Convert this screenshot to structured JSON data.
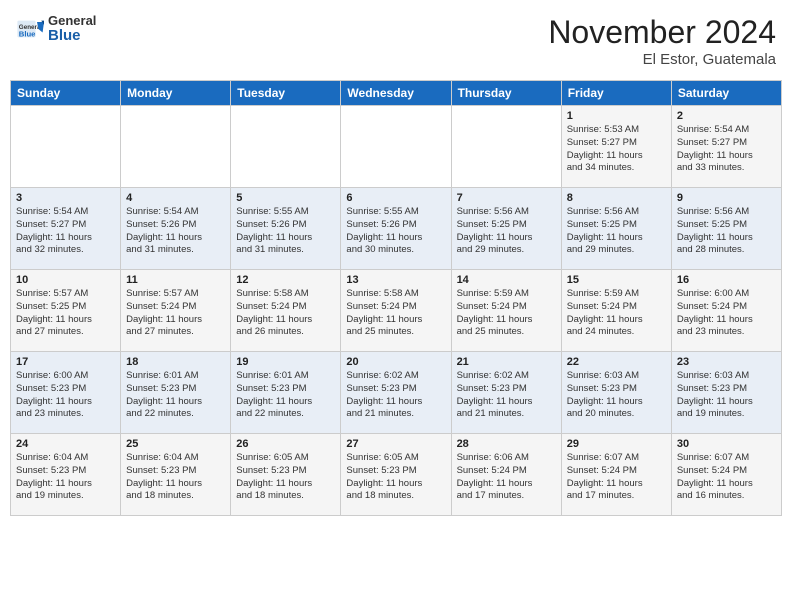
{
  "header": {
    "logo_general": "General",
    "logo_blue": "Blue",
    "month": "November 2024",
    "location": "El Estor, Guatemala"
  },
  "weekdays": [
    "Sunday",
    "Monday",
    "Tuesday",
    "Wednesday",
    "Thursday",
    "Friday",
    "Saturday"
  ],
  "weeks": [
    [
      {
        "day": "",
        "info": ""
      },
      {
        "day": "",
        "info": ""
      },
      {
        "day": "",
        "info": ""
      },
      {
        "day": "",
        "info": ""
      },
      {
        "day": "",
        "info": ""
      },
      {
        "day": "1",
        "info": "Sunrise: 5:53 AM\nSunset: 5:27 PM\nDaylight: 11 hours\nand 34 minutes."
      },
      {
        "day": "2",
        "info": "Sunrise: 5:54 AM\nSunset: 5:27 PM\nDaylight: 11 hours\nand 33 minutes."
      }
    ],
    [
      {
        "day": "3",
        "info": "Sunrise: 5:54 AM\nSunset: 5:27 PM\nDaylight: 11 hours\nand 32 minutes."
      },
      {
        "day": "4",
        "info": "Sunrise: 5:54 AM\nSunset: 5:26 PM\nDaylight: 11 hours\nand 31 minutes."
      },
      {
        "day": "5",
        "info": "Sunrise: 5:55 AM\nSunset: 5:26 PM\nDaylight: 11 hours\nand 31 minutes."
      },
      {
        "day": "6",
        "info": "Sunrise: 5:55 AM\nSunset: 5:26 PM\nDaylight: 11 hours\nand 30 minutes."
      },
      {
        "day": "7",
        "info": "Sunrise: 5:56 AM\nSunset: 5:25 PM\nDaylight: 11 hours\nand 29 minutes."
      },
      {
        "day": "8",
        "info": "Sunrise: 5:56 AM\nSunset: 5:25 PM\nDaylight: 11 hours\nand 29 minutes."
      },
      {
        "day": "9",
        "info": "Sunrise: 5:56 AM\nSunset: 5:25 PM\nDaylight: 11 hours\nand 28 minutes."
      }
    ],
    [
      {
        "day": "10",
        "info": "Sunrise: 5:57 AM\nSunset: 5:25 PM\nDaylight: 11 hours\nand 27 minutes."
      },
      {
        "day": "11",
        "info": "Sunrise: 5:57 AM\nSunset: 5:24 PM\nDaylight: 11 hours\nand 27 minutes."
      },
      {
        "day": "12",
        "info": "Sunrise: 5:58 AM\nSunset: 5:24 PM\nDaylight: 11 hours\nand 26 minutes."
      },
      {
        "day": "13",
        "info": "Sunrise: 5:58 AM\nSunset: 5:24 PM\nDaylight: 11 hours\nand 25 minutes."
      },
      {
        "day": "14",
        "info": "Sunrise: 5:59 AM\nSunset: 5:24 PM\nDaylight: 11 hours\nand 25 minutes."
      },
      {
        "day": "15",
        "info": "Sunrise: 5:59 AM\nSunset: 5:24 PM\nDaylight: 11 hours\nand 24 minutes."
      },
      {
        "day": "16",
        "info": "Sunrise: 6:00 AM\nSunset: 5:24 PM\nDaylight: 11 hours\nand 23 minutes."
      }
    ],
    [
      {
        "day": "17",
        "info": "Sunrise: 6:00 AM\nSunset: 5:23 PM\nDaylight: 11 hours\nand 23 minutes."
      },
      {
        "day": "18",
        "info": "Sunrise: 6:01 AM\nSunset: 5:23 PM\nDaylight: 11 hours\nand 22 minutes."
      },
      {
        "day": "19",
        "info": "Sunrise: 6:01 AM\nSunset: 5:23 PM\nDaylight: 11 hours\nand 22 minutes."
      },
      {
        "day": "20",
        "info": "Sunrise: 6:02 AM\nSunset: 5:23 PM\nDaylight: 11 hours\nand 21 minutes."
      },
      {
        "day": "21",
        "info": "Sunrise: 6:02 AM\nSunset: 5:23 PM\nDaylight: 11 hours\nand 21 minutes."
      },
      {
        "day": "22",
        "info": "Sunrise: 6:03 AM\nSunset: 5:23 PM\nDaylight: 11 hours\nand 20 minutes."
      },
      {
        "day": "23",
        "info": "Sunrise: 6:03 AM\nSunset: 5:23 PM\nDaylight: 11 hours\nand 19 minutes."
      }
    ],
    [
      {
        "day": "24",
        "info": "Sunrise: 6:04 AM\nSunset: 5:23 PM\nDaylight: 11 hours\nand 19 minutes."
      },
      {
        "day": "25",
        "info": "Sunrise: 6:04 AM\nSunset: 5:23 PM\nDaylight: 11 hours\nand 18 minutes."
      },
      {
        "day": "26",
        "info": "Sunrise: 6:05 AM\nSunset: 5:23 PM\nDaylight: 11 hours\nand 18 minutes."
      },
      {
        "day": "27",
        "info": "Sunrise: 6:05 AM\nSunset: 5:23 PM\nDaylight: 11 hours\nand 18 minutes."
      },
      {
        "day": "28",
        "info": "Sunrise: 6:06 AM\nSunset: 5:24 PM\nDaylight: 11 hours\nand 17 minutes."
      },
      {
        "day": "29",
        "info": "Sunrise: 6:07 AM\nSunset: 5:24 PM\nDaylight: 11 hours\nand 17 minutes."
      },
      {
        "day": "30",
        "info": "Sunrise: 6:07 AM\nSunset: 5:24 PM\nDaylight: 11 hours\nand 16 minutes."
      }
    ]
  ]
}
